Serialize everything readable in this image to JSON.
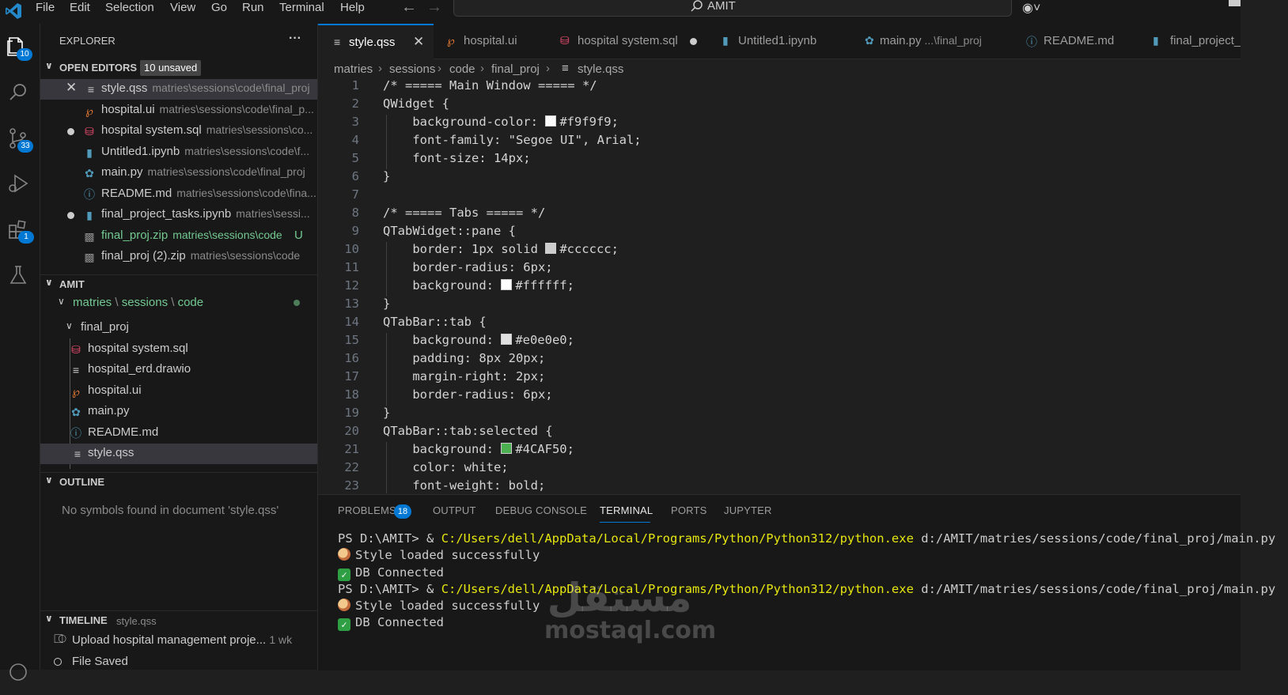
{
  "menubar": {
    "items": [
      "File",
      "Edit",
      "Selection",
      "View",
      "Go",
      "Run",
      "Terminal",
      "Help"
    ],
    "search_label": "AMIT"
  },
  "activitybar": {
    "explorer_badge": "10",
    "scm_badge": "33",
    "extensions_badge": "1"
  },
  "sidebar": {
    "title": "EXPLORER",
    "more": "···",
    "open_editors": {
      "label": "OPEN EDITORS",
      "badge": "10 unsaved",
      "items": [
        {
          "name": "style.qss",
          "path": "matries\\sessions\\code\\final_proj"
        },
        {
          "name": "hospital.ui",
          "path": "matries\\sessions\\code\\final_p..."
        },
        {
          "name": "hospital system.sql",
          "path": "matries\\sessions\\co..."
        },
        {
          "name": "Untitled1.ipynb",
          "path": "matries\\sessions\\code\\f..."
        },
        {
          "name": "main.py",
          "path": "matries\\sessions\\code\\final_proj"
        },
        {
          "name": "README.md",
          "path": "matries\\sessions\\code\\fina..."
        },
        {
          "name": "final_project_tasks.ipynb",
          "path": "matries\\sessi..."
        },
        {
          "name": "final_proj.zip",
          "path": "matries\\sessions\\code",
          "status": "U"
        },
        {
          "name": "final_proj (2).zip",
          "path": "matries\\sessions\\code"
        }
      ]
    },
    "workspace": {
      "label": "AMIT",
      "folder_path": [
        "matries",
        "sessions",
        "code"
      ],
      "subfolder": "final_proj",
      "files": [
        "hospital system.sql",
        "hospital_erd.drawio",
        "hospital.ui",
        "main.py",
        "README.md",
        "style.qss"
      ]
    },
    "outline": {
      "label": "OUTLINE",
      "empty_message": "No symbols found in document 'style.qss'"
    },
    "timeline": {
      "label": "TIMELINE",
      "file": "style.qss",
      "items": [
        {
          "text": "Upload hospital management proje...",
          "time": "1 wk"
        },
        {
          "text": "File Saved",
          "time": ""
        }
      ]
    }
  },
  "tabs": [
    {
      "label": "style.qss",
      "desc": ""
    },
    {
      "label": "hospital.ui",
      "desc": ""
    },
    {
      "label": "hospital system.sql",
      "desc": ""
    },
    {
      "label": "Untitled1.ipynb",
      "desc": ""
    },
    {
      "label": "main.py",
      "desc": "...\\final_proj"
    },
    {
      "label": "README.md",
      "desc": ""
    },
    {
      "label": "final_project_",
      "desc": ""
    }
  ],
  "breadcrumb": [
    "matries",
    "sessions",
    "code",
    "final_proj",
    "style.qss"
  ],
  "editor": {
    "lines": [
      "/* ===== Main Window ===== */",
      "QWidget {",
      "    background-color: #f9f9f9;",
      "    font-family: \"Segoe UI\", Arial;",
      "    font-size: 14px;",
      "}",
      "",
      "/* ===== Tabs ===== */",
      "QTabWidget::pane {",
      "    border: 1px solid #cccccc;",
      "    border-radius: 6px;",
      "    background: #ffffff;",
      "}",
      "QTabBar::tab {",
      "    background: #e0e0e0;",
      "    padding: 8px 20px;",
      "    margin-right: 2px;",
      "    border-radius: 6px;",
      "}",
      "QTabBar::tab:selected {",
      "    background: #4CAF50;",
      "    color: white;",
      "    font-weight: bold;"
    ]
  },
  "panel": {
    "tabs": [
      "PROBLEMS",
      "OUTPUT",
      "DEBUG CONSOLE",
      "TERMINAL",
      "PORTS",
      "JUPYTER"
    ],
    "problems_count": "18",
    "terminal": {
      "prompt": "PS D:\\AMIT>",
      "amp": "&",
      "exe": "C:/Users/dell/AppData/Local/Programs/Python/Python312/python.exe",
      "script": "d:/AMIT/matries/sessions/code/final_proj/main.py",
      "style_msg": "Style loaded successfully",
      "db_msg": "DB Connected"
    }
  },
  "watermark": {
    "arabic": "مستقل",
    "latin": "mostaql.com"
  },
  "colors": {
    "accent": "#0078d4",
    "swatches": [
      "#f9f9f9",
      "#cccccc",
      "#ffffff",
      "#e0e0e0",
      "#4CAF50"
    ]
  }
}
